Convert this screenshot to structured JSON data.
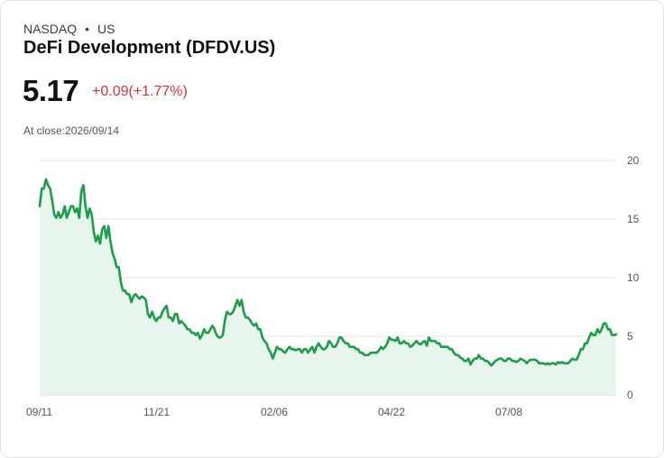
{
  "header": {
    "exchange": "NASDAQ",
    "separator": "•",
    "region": "US",
    "title": "DeFi Development (DFDV.US)",
    "price": "5.17",
    "change": "+0.09(+1.77%)",
    "close_label": "At close:2026/09/14"
  },
  "colors": {
    "line": "#1a9e48",
    "fill": "#e8f5ec",
    "change": "#d8303a",
    "grid": "#e6e6e6"
  },
  "chart_data": {
    "type": "area",
    "x_tick_labels": [
      "09/11",
      "11/21",
      "02/06",
      "04/22",
      "07/08"
    ],
    "y_ticks": [
      0,
      5,
      10,
      15,
      20
    ],
    "ylim": [
      0,
      20
    ],
    "y_axis_side": "right",
    "grid": true,
    "values": [
      16.1,
      17.6,
      17.6,
      18.4,
      17.9,
      17.6,
      16.6,
      15.4,
      15.1,
      15.6,
      15.1,
      15.4,
      16.1,
      15.1,
      15.6,
      16.1,
      16.1,
      15.6,
      15.9,
      15.1,
      17.4,
      17.9,
      16.1,
      15.1,
      15.9,
      15.4,
      13.9,
      13.1,
      13.6,
      12.9,
      14.1,
      14.4,
      13.4,
      14.4,
      13.1,
      12.1,
      11.6,
      10.9,
      10.9,
      9.6,
      8.9,
      8.9,
      8.6,
      8.6,
      7.9,
      8.4,
      8.6,
      8.4,
      8.2,
      8.4,
      8.3,
      8.1,
      6.9,
      6.6,
      7.1,
      6.6,
      6.3,
      6.6,
      6.6,
      7.1,
      7.4,
      7.6,
      6.6,
      6.6,
      6.3,
      6.9,
      6.9,
      6.1,
      6.3,
      6.1,
      5.9,
      5.6,
      5.6,
      5.3,
      5.3,
      5.1,
      5.3,
      4.8,
      5.1,
      5.6,
      5.3,
      5.3,
      5.6,
      5.9,
      5.6,
      5.1,
      4.9,
      4.9,
      5.1,
      6.4,
      7.1,
      6.9,
      6.9,
      7.1,
      7.6,
      8.1,
      7.6,
      8.1,
      7.1,
      6.6,
      6.6,
      6.4,
      6.1,
      5.9,
      6.1,
      5.6,
      5.6,
      4.9,
      4.6,
      4.4,
      3.9,
      3.6,
      3.1,
      3.6,
      4.1,
      3.9,
      3.9,
      3.7,
      3.6,
      3.9,
      4.1,
      3.9,
      3.9,
      3.8,
      3.9,
      3.9,
      3.6,
      3.9,
      3.9,
      3.6,
      3.9,
      4.1,
      3.6,
      4.1,
      4.4,
      4.1,
      3.9,
      3.9,
      4.1,
      4.6,
      4.4,
      4.1,
      4.1,
      4.4,
      4.9,
      4.9,
      4.6,
      4.4,
      4.4,
      4.1,
      4.1,
      4.1,
      3.9,
      3.9,
      3.6,
      3.6,
      3.4,
      3.4,
      3.4,
      3.6,
      3.6,
      3.6,
      3.6,
      3.8,
      4.1,
      3.9,
      4.1,
      4.4,
      4.9,
      4.7,
      4.7,
      4.6,
      4.9,
      4.4,
      4.4,
      4.6,
      4.4,
      4.4,
      4.1,
      4.2,
      4.4,
      4.6,
      4.4,
      4.3,
      4.5,
      4.6,
      4.2,
      4.9,
      4.6,
      4.6,
      4.6,
      4.4,
      4.4,
      4.1,
      4.1,
      4.1,
      4.1,
      3.9,
      3.9,
      3.6,
      3.4,
      3.4,
      3.2,
      3.1,
      2.9,
      2.9,
      3.1,
      2.6,
      2.9,
      3.1,
      3.1,
      3.4,
      3.1,
      3.1,
      2.9,
      2.9,
      2.7,
      2.5,
      2.7,
      2.9,
      3.0,
      3.1,
      3.1,
      2.9,
      2.9,
      3.1,
      3.1,
      2.9,
      2.9,
      2.8,
      2.9,
      3.1,
      3.0,
      2.9,
      2.7,
      2.9,
      3.0,
      3.0,
      3.0,
      2.9,
      2.7,
      2.7,
      2.7,
      2.6,
      2.7,
      2.6,
      2.7,
      2.7,
      2.6,
      2.8,
      2.7,
      2.8,
      2.7,
      2.7,
      2.7,
      2.9,
      3.1,
      3.0,
      3.0,
      3.4,
      3.9,
      3.9,
      4.4,
      4.4,
      4.9,
      5.3,
      5.1,
      5.1,
      5.6,
      5.3,
      5.6,
      6.1,
      6.1,
      5.6,
      5.6,
      5.1,
      5.1,
      5.17
    ]
  }
}
